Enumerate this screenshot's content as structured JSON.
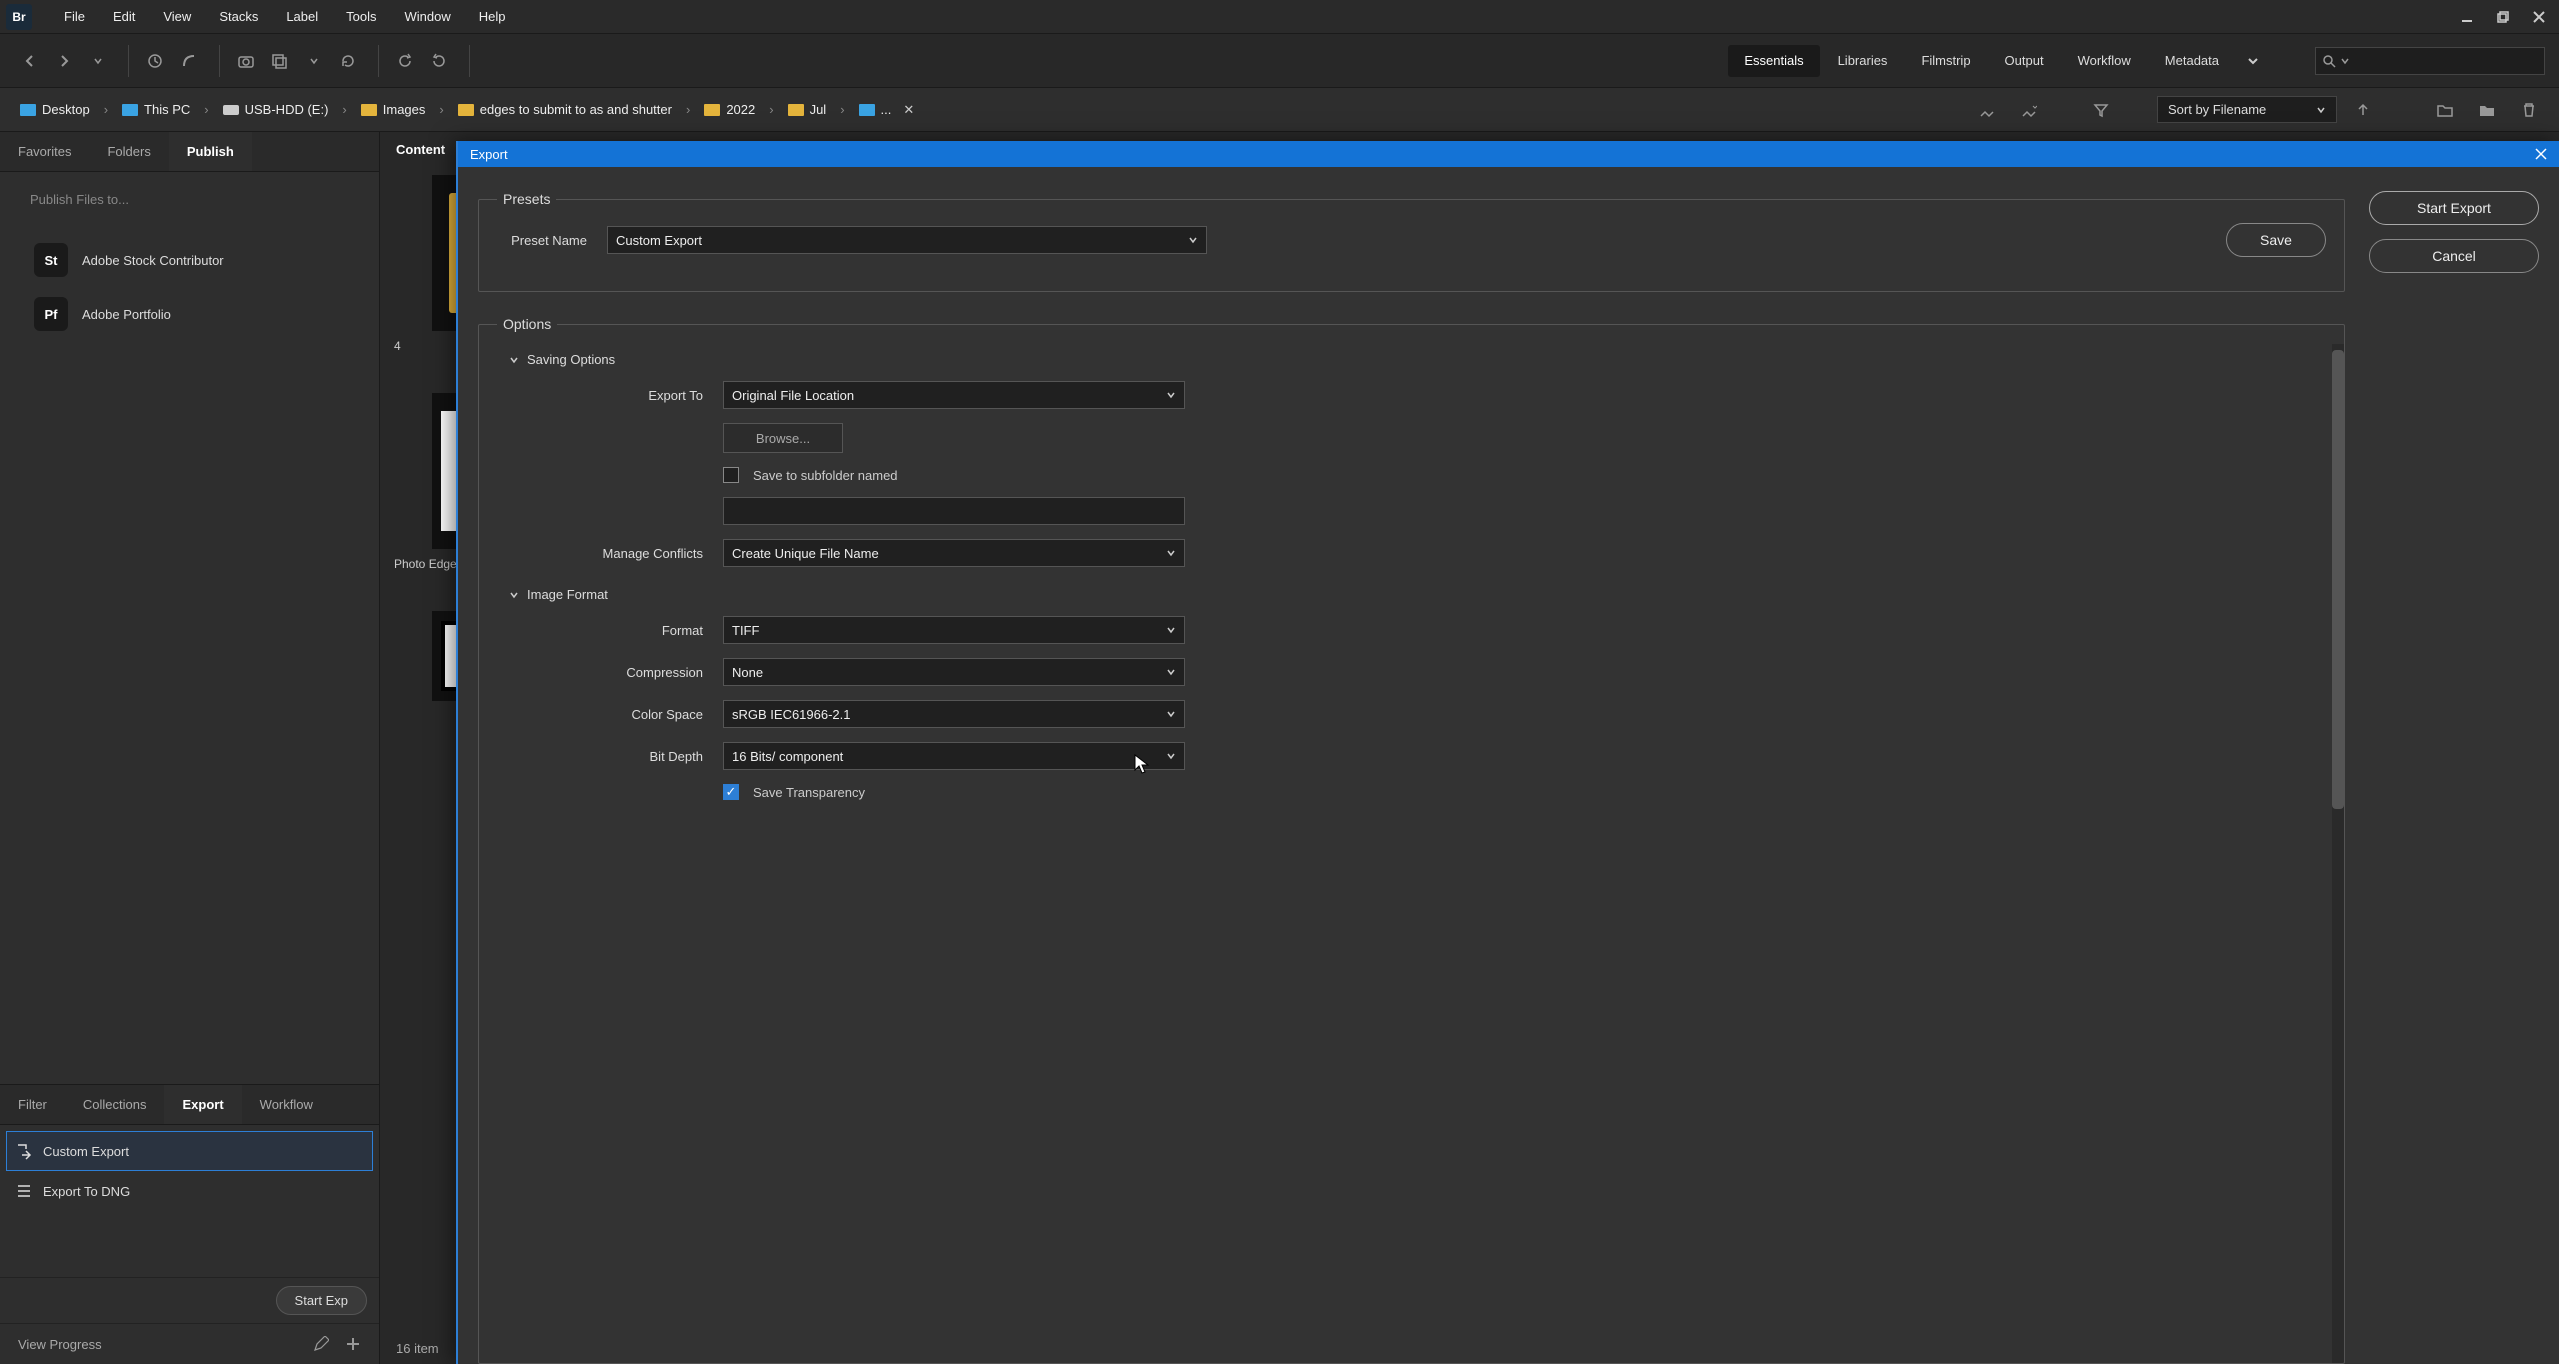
{
  "app": {
    "badge": "Br"
  },
  "menu": [
    "File",
    "Edit",
    "View",
    "Stacks",
    "Label",
    "Tools",
    "Window",
    "Help"
  ],
  "workspaces": [
    "Essentials",
    "Libraries",
    "Filmstrip",
    "Output",
    "Workflow",
    "Metadata"
  ],
  "workspace_active": "Essentials",
  "breadcrumb": {
    "items": [
      {
        "icon": "disk",
        "label": "Desktop"
      },
      {
        "icon": "disk",
        "label": "This PC"
      },
      {
        "icon": "drive",
        "label": "USB-HDD (E:)"
      },
      {
        "icon": "folder",
        "label": "Images"
      },
      {
        "icon": "folder",
        "label": "edges to submit to as and shutter"
      },
      {
        "icon": "folder",
        "label": "2022"
      },
      {
        "icon": "folder",
        "label": "Jul"
      },
      {
        "icon": "disk",
        "label": "..."
      }
    ],
    "sort_label": "Sort by Filename"
  },
  "left_tabs_upper": [
    "Favorites",
    "Folders",
    "Publish"
  ],
  "left_upper_active": "Publish",
  "publish": {
    "hint": "Publish Files to...",
    "targets": [
      {
        "badge": "St",
        "label": "Adobe Stock Contributor"
      },
      {
        "badge": "Pf",
        "label": "Adobe Portfolio"
      }
    ]
  },
  "left_tabs_lower": [
    "Filter",
    "Collections",
    "Export",
    "Workflow"
  ],
  "left_lower_active": "Export",
  "export_list": {
    "items": [
      {
        "label": "Custom Export",
        "selected": true
      },
      {
        "label": "Export To DNG",
        "selected": false
      }
    ],
    "create_label": "Create new Preset",
    "start_label": "Start Exp",
    "view_progress": "View Progress"
  },
  "content": {
    "header": "Content",
    "thumb1_label": "4",
    "thumb2_label": "Photo Edge",
    "status": "16 item"
  },
  "dialog": {
    "title": "Export",
    "start_btn": "Start Export",
    "cancel_btn": "Cancel",
    "presets_legend": "Presets",
    "preset_name_label": "Preset Name",
    "preset_name_value": "Custom Export",
    "save_btn": "Save",
    "options_legend": "Options",
    "saving_header": "Saving Options",
    "export_to_label": "Export To",
    "export_to_value": "Original File Location",
    "browse_label": "Browse...",
    "subfolder_label": "Save to subfolder named",
    "conflicts_label": "Manage Conflicts",
    "conflicts_value": "Create Unique File Name",
    "image_format_header": "Image Format",
    "format_label": "Format",
    "format_value": "TIFF",
    "compression_label": "Compression",
    "compression_value": "None",
    "colorspace_label": "Color Space",
    "colorspace_value": "sRGB IEC61966-2.1",
    "bitdepth_label": "Bit Depth",
    "bitdepth_value": "16 Bits/ component",
    "transparency_label": "Save Transparency"
  }
}
